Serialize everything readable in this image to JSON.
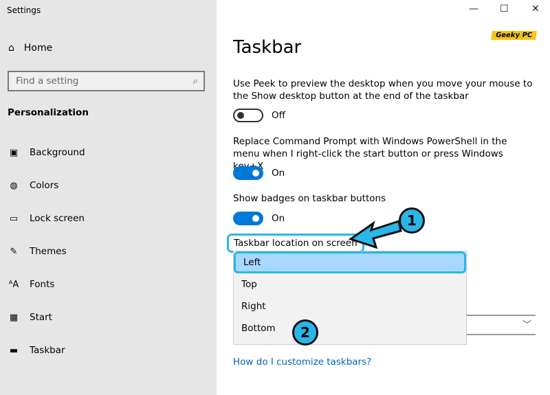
{
  "window": {
    "title": "Settings",
    "minimize": "—",
    "maximize": "☐",
    "close": "✕"
  },
  "sidebar": {
    "home": "Home",
    "search_placeholder": "Find a setting",
    "section": "Personalization",
    "items": [
      {
        "label": "Background",
        "icon": "🖼"
      },
      {
        "label": "Colors",
        "icon": "🎨"
      },
      {
        "label": "Lock screen",
        "icon": "▭"
      },
      {
        "label": "Themes",
        "icon": "✎"
      },
      {
        "label": "Fonts",
        "icon": "ᴬA"
      },
      {
        "label": "Start",
        "icon": "▦"
      },
      {
        "label": "Taskbar",
        "icon": "▭"
      }
    ]
  },
  "watermark": "Geeky PC",
  "main": {
    "title": "Taskbar",
    "peek": {
      "desc": "Use Peek to preview the desktop when you move your mouse to the Show desktop button at the end of the taskbar",
      "state": "Off"
    },
    "powershell": {
      "desc": "Replace Command Prompt with Windows PowerShell in the menu when I right-click the start button or press Windows key+X",
      "state": "On"
    },
    "badges": {
      "desc": "Show badges on taskbar buttons",
      "state": "On"
    },
    "location": {
      "label": "Taskbar location on screen",
      "options": [
        "Left",
        "Top",
        "Right",
        "Bottom"
      ],
      "selected": "Left"
    },
    "link": "How do I customize taskbars?"
  },
  "annotations": [
    "1",
    "2"
  ],
  "colors": {
    "accent": "#0078d7",
    "highlight": "#29b6e8"
  }
}
